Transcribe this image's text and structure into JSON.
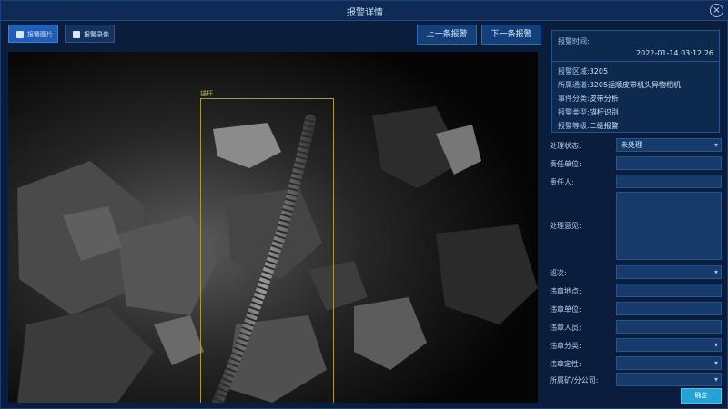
{
  "window": {
    "title": "报警详情"
  },
  "tabs": [
    {
      "label": "报警图片"
    },
    {
      "label": "报警录像"
    }
  ],
  "nav": {
    "prev_label": "上一条报警",
    "next_label": "下一条报警"
  },
  "detection": {
    "label": "锚杆"
  },
  "alarm_info": {
    "time_label": "报警时间:",
    "time_value": "2022-01-14 03:12:26",
    "rows": [
      {
        "key": "报警区域:",
        "value": "3205"
      },
      {
        "key": "所属通道:",
        "value": "3205运顺皮带机头异物相机"
      },
      {
        "key": "事件分类:",
        "value": "皮带分析"
      },
      {
        "key": "报警类型:",
        "value": "锚杆识别"
      },
      {
        "key": "报警等级:",
        "value": "二级报警"
      }
    ]
  },
  "form": {
    "status_label": "处理状态:",
    "status_value": "未处理",
    "unit_label": "责任单位:",
    "person_label": "责任人:",
    "opinion_label": "处理意见:",
    "shift_label": "班次:",
    "violation_place_label": "违章地点:",
    "violation_unit_label": "违章单位:",
    "violation_person_label": "违章人员:",
    "violation_category_label": "违章分类:",
    "violation_nature_label": "违章定性:",
    "branch_label": "所属矿/分公司:"
  },
  "confirm_label": "确定",
  "colors": {
    "accent": "#1f5fb8",
    "confirm": "#23a3d8",
    "detect_box": "#a99b36"
  },
  "icons": {
    "close": "close-icon"
  }
}
